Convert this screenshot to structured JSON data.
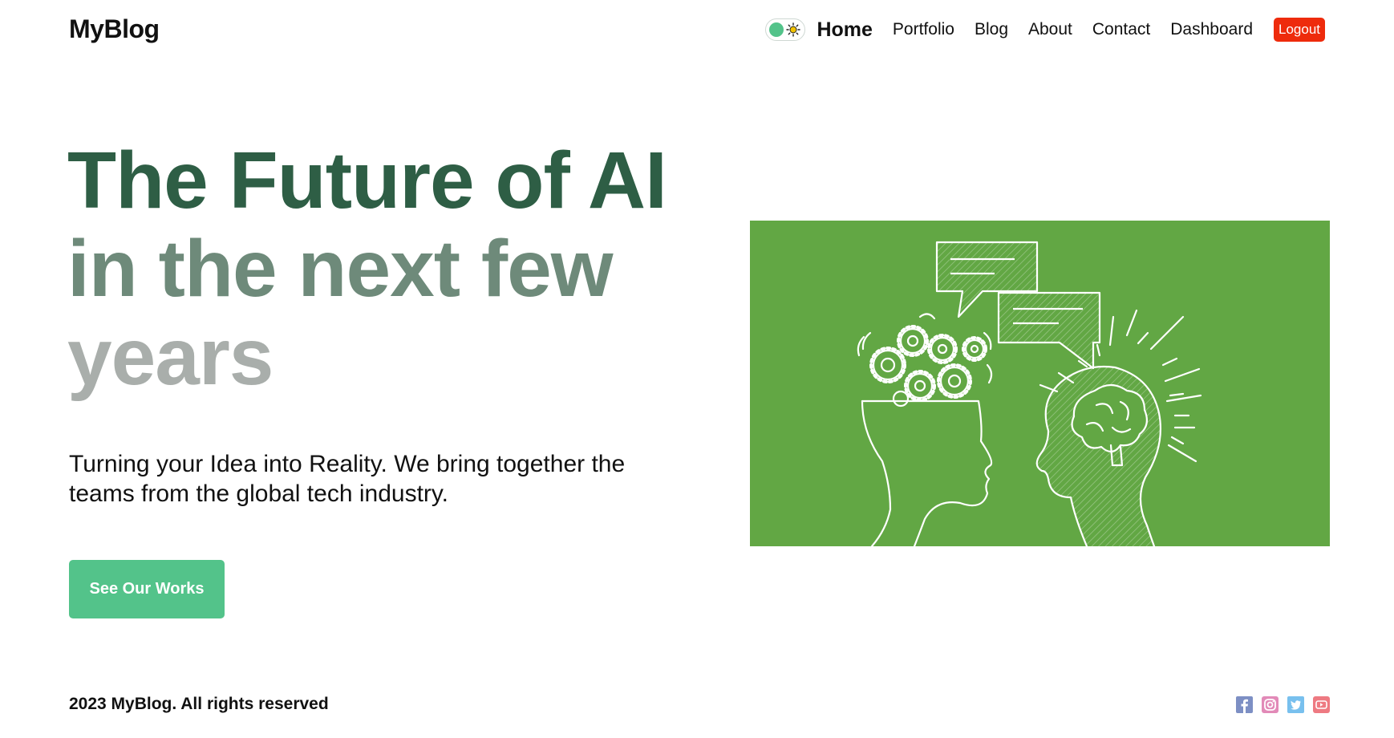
{
  "header": {
    "logo": "MyBlog",
    "nav": {
      "home": "Home",
      "portfolio": "Portfolio",
      "blog": "Blog",
      "about": "About",
      "contact": "Contact",
      "dashboard": "Dashboard",
      "logout": "Logout"
    },
    "theme_toggle": {
      "state": "light",
      "icon": "sun-icon"
    }
  },
  "hero": {
    "title_lines": [
      "The Future of AI",
      "in the next few",
      "years"
    ],
    "subtitle": "Turning your Idea into Reality. We bring together the teams from the global tech industry.",
    "cta_label": "See Our Works",
    "illustration_icons": [
      "gears-head-icon",
      "speech-bubbles-icon",
      "brain-head-icon"
    ]
  },
  "footer": {
    "copyright": "2023 MyBlog. All rights reserved",
    "social_icons": [
      "facebook-icon",
      "instagram-icon",
      "twitter-icon",
      "youtube-icon"
    ]
  },
  "colors": {
    "accent": "#53c38a",
    "logout": "#ee2b0c",
    "illustration_bg": "#62a744",
    "title_line1": "#2e5e45",
    "title_line2": "#6e8a7a",
    "title_line3": "#a9aeab"
  }
}
